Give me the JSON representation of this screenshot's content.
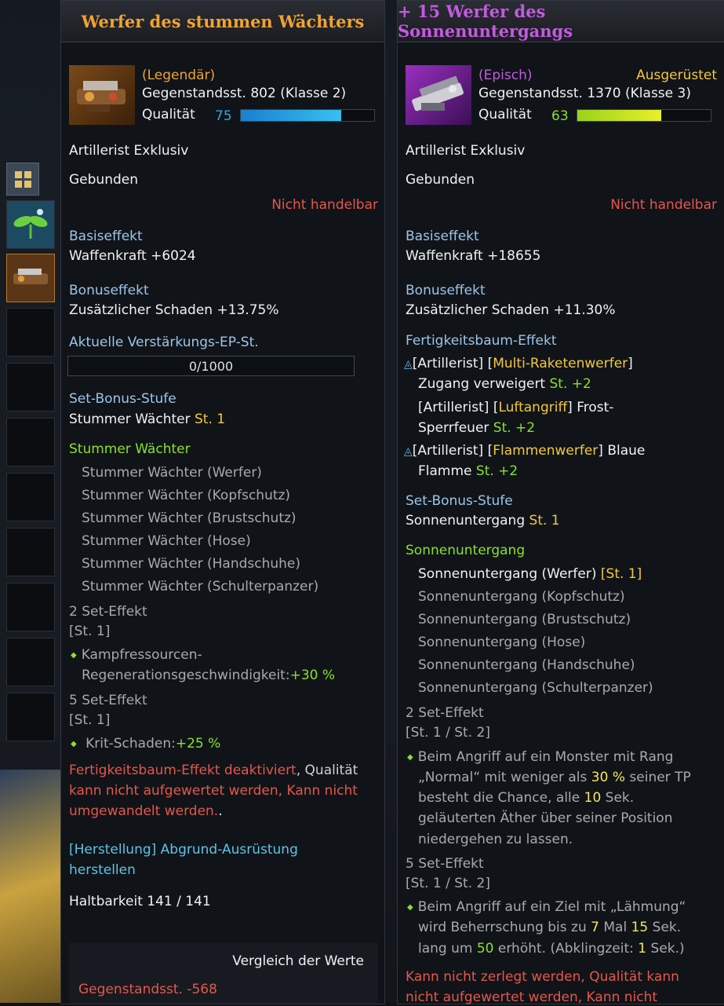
{
  "left": {
    "title": "Werfer des stummen Wächters",
    "rarity": "(Legendär)",
    "item_level": "Gegenstandsst. 802 (Klasse 2)",
    "quality_label": "Qualität",
    "quality_value": "75",
    "quality_fraction": 0.75,
    "class_line": "Artillerist Exklusiv",
    "bound": "Gebunden",
    "trade": "Nicht handelbar",
    "base_title": "Basiseffekt",
    "base_value": "Waffenkraft +6024",
    "bonus_title": "Bonuseffekt",
    "bonus_value": "Zusätzlicher Schaden +13.75%",
    "ep_title": "Aktuelle Verstärkungs-EP-St.",
    "ep_value": "0/1000",
    "set_title": "Set-Bonus-Stufe",
    "set_name": "Stummer Wächter",
    "set_level": "St. 1",
    "set_group": "Stummer Wächter",
    "set_items": [
      "Stummer Wächter (Werfer)",
      "Stummer Wächter (Kopfschutz)",
      "Stummer Wächter (Brustschutz)",
      "Stummer Wächter (Hose)",
      "Stummer Wächter (Handschuhe)",
      "Stummer Wächter (Schulterpanzer)"
    ],
    "set2_title": "2 Set-Effekt",
    "set2_level": "[St. 1]",
    "set2_text1": "Kampfressourcen-",
    "set2_text2": "Regenerationsgeschwindigkeit:",
    "set2_val": "+30 %",
    "set5_title": "5 Set-Effekt",
    "set5_level": "[St. 1]",
    "set5_text": "Krit-Schaden:",
    "set5_val": "+25 %",
    "warn1a": "Fertigkeitsbaum-Effekt deaktiviert",
    "warn1b": ", Qualität",
    "warn2": "kann nicht aufgewertet werden",
    "warn2b": ", Kann nicht",
    "warn3": "umgewandelt werden.",
    "warn3b": ".",
    "craft1": "[Herstellung] Abgrund-Ausrüstung",
    "craft2": "herstellen",
    "durability": "Haltbarkeit 141 / 141",
    "compare_title": "Vergleich der Werte",
    "compare_value": "Gegenstandsst. -568"
  },
  "right": {
    "title": "+ 15 Werfer des Sonnenuntergangs",
    "rarity": "(Episch)",
    "equipped": "Ausgerüstet",
    "item_level": "Gegenstandsst. 1370 (Klasse 3)",
    "quality_label": "Qualität",
    "quality_value": "63",
    "quality_fraction": 0.63,
    "class_line": "Artillerist Exklusiv",
    "bound": "Gebunden",
    "trade": "Nicht handelbar",
    "base_title": "Basiseffekt",
    "base_value": "Waffenkraft +18655",
    "bonus_title": "Bonuseffekt",
    "bonus_value": "Zusätzlicher Schaden +11.30%",
    "skill_title": "Fertigkeitsbaum-Effekt",
    "skill1_pre": "[Artillerist] [",
    "skill1_name": "Multi-Raketenwerfer",
    "skill1_post": "]",
    "skill1_l2": "Zugang verweigert ",
    "skill1_lvl": "St. +2",
    "skill2_pre": "[Artillerist] [",
    "skill2_name": "Luftangriff",
    "skill2_post": "] Frost-",
    "skill2_l2": "Sperrfeuer ",
    "skill2_lvl": "St. +2",
    "skill3_pre": "[Artillerist] [",
    "skill3_name": "Flammenwerfer",
    "skill3_post": "] Blaue",
    "skill3_l2": "Flamme ",
    "skill3_lvl": "St. +2",
    "set_title": "Set-Bonus-Stufe",
    "set_name": "Sonnenuntergang",
    "set_level": "St. 1",
    "set_group": "Sonnenuntergang",
    "set_item_active": "Sonnenuntergang (Werfer) ",
    "set_item_active_lvl": "[St. 1]",
    "set_items": [
      "Sonnenuntergang (Kopfschutz)",
      "Sonnenuntergang (Brustschutz)",
      "Sonnenuntergang (Hose)",
      "Sonnenuntergang (Handschuhe)",
      "Sonnenuntergang (Schulterpanzer)"
    ],
    "set2_title": "2 Set-Effekt",
    "set2_level": "[St. 1 / St. 2]",
    "set2_l1": "Beim Angriff auf ein Monster mit Rang",
    "set2_l2a": "„Normal“ mit weniger als ",
    "set2_l2v": "30 %",
    "set2_l2b": " seiner TP",
    "set2_l3a": "besteht die Chance, alle ",
    "set2_l3v": "10",
    "set2_l3b": " Sek.",
    "set2_l4": "geläuterten Äther über seiner Position",
    "set2_l5": "niedergehen zu lassen.",
    "set5_title": "5 Set-Effekt",
    "set5_level": "[St. 1 / St. 2]",
    "set5_l1": "Beim Angriff auf ein Ziel mit „Lähmung“",
    "set5_l2a": "wird Beherrschung bis zu ",
    "set5_l2v1": "7",
    "set5_l2m": " Mal ",
    "set5_l2v2": "15",
    "set5_l2b": " Sek.",
    "set5_l3a": "lang um ",
    "set5_l3v": "50",
    "set5_l3b": " erhöht. (Abklingzeit: ",
    "set5_l3v2": "1",
    "set5_l3c": " Sek.)",
    "warn1a": "Kann nicht zerlegt werden",
    "warn1b": ", Qualität kann",
    "warn2a": "nicht aufgewertet werden",
    "warn2b": ", Kann nicht"
  },
  "colors": {
    "legendary": "#f0a332",
    "epic": "#c45ae0",
    "quality_blue": "#2aa8e0",
    "quality_green": "#c8e61e"
  }
}
